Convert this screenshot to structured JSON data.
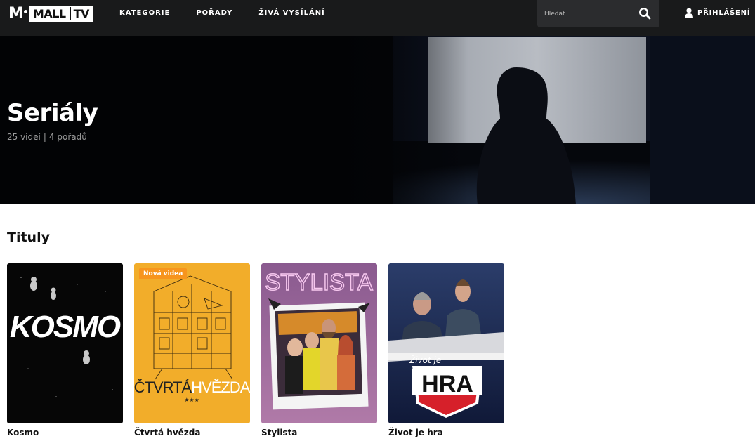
{
  "header": {
    "logo_text": "MALL",
    "logo_tv": "TV",
    "nav": [
      "KATEGORIE",
      "POŘADY",
      "ŽIVÁ VYSÍLÁNÍ"
    ],
    "search_placeholder": "Hledat",
    "login_label": "PŘIHLÁŠENÍ"
  },
  "hero": {
    "title": "Seriály",
    "videos": "25 videí",
    "shows": "4 pořadů"
  },
  "section": {
    "title": "Tituly",
    "cards": [
      {
        "title": "Kosmo",
        "poster_text": "KOSMO"
      },
      {
        "title": "Čtvrtá hvězda",
        "badge": "Nová videa",
        "poster_text_a": "ČTVRTÁ",
        "poster_text_b": "HVĚZDA"
      },
      {
        "title": "Stylista",
        "poster_text": "STYLISTA"
      },
      {
        "title": "Život je hra",
        "poster_text_a": "Život je",
        "poster_text_b": "HRA"
      }
    ]
  },
  "colors": {
    "topbar": "#191a1b",
    "badge": "#f7951d",
    "hvezda_poster": "#f2ad2a",
    "hra_red": "#d6202a"
  }
}
